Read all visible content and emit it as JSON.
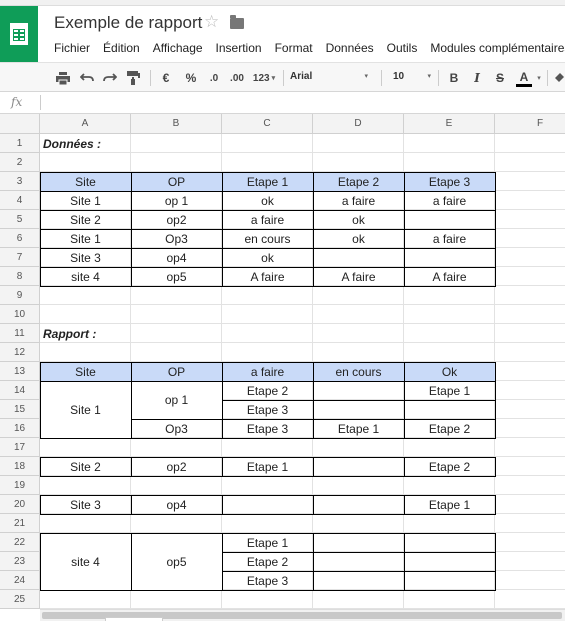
{
  "app": {
    "title": "Exemple de rapport",
    "menu": [
      "Fichier",
      "Édition",
      "Affichage",
      "Insertion",
      "Format",
      "Données",
      "Outils",
      "Modules complémentaires"
    ]
  },
  "toolbar": {
    "currency": "€",
    "percent": "%",
    "dec_less": ".0",
    "dec_more": ".00",
    "number_format": "123",
    "font": "Arial",
    "font_size": "10",
    "bold": "B",
    "italic": "I",
    "strike": "S",
    "text_color": "A"
  },
  "formula_bar": {
    "fx": "fx",
    "value": ""
  },
  "sheet": {
    "columns": [
      "A",
      "B",
      "C",
      "D",
      "E",
      "F"
    ],
    "rows": [
      "1",
      "2",
      "3",
      "4",
      "5",
      "6",
      "7",
      "8",
      "9",
      "10",
      "11",
      "12",
      "13",
      "14",
      "15",
      "16",
      "17",
      "18",
      "19",
      "20",
      "21",
      "22",
      "23",
      "24",
      "25"
    ],
    "heading_donnees": "Données :",
    "heading_rapport": "Rapport :",
    "data_header": [
      "Site",
      "OP",
      "Etape 1",
      "Etape 2",
      "Etape 3"
    ],
    "data_rows": [
      [
        "Site 1",
        "op 1",
        "ok",
        "a faire",
        "a faire"
      ],
      [
        "Site 2",
        "op2",
        "a faire",
        "ok",
        ""
      ],
      [
        "Site 1",
        "Op3",
        "en cours",
        "ok",
        "a faire"
      ],
      [
        "Site 3",
        "op4",
        "ok",
        "",
        ""
      ],
      [
        "site 4",
        "op5",
        "A faire",
        "A faire",
        "A faire"
      ]
    ],
    "report_header": [
      "Site",
      "OP",
      "a faire",
      "en cours",
      "Ok"
    ],
    "report": {
      "site1": "Site 1",
      "op1": "op 1",
      "op3": "Op3",
      "r14_c": "Etape 2",
      "r14_e": "Etape 1",
      "r15_c": "Etape 3",
      "r16_c": "Etape 3",
      "r16_d": "Etape 1",
      "r16_e": "Etape 2",
      "site2": "Site 2",
      "op2": "op2",
      "r18_c": "Etape 1",
      "r18_e": "Etape 2",
      "site3": "Site 3",
      "op4": "op4",
      "r20_e": "Etape 1",
      "site4": "site 4",
      "op5": "op5",
      "r22_c": "Etape 1",
      "r23_c": "Etape 2",
      "r24_c": "Etape 3"
    }
  },
  "colors": {
    "brand": "#0f9d58",
    "header_fill": "#c9daf8"
  }
}
